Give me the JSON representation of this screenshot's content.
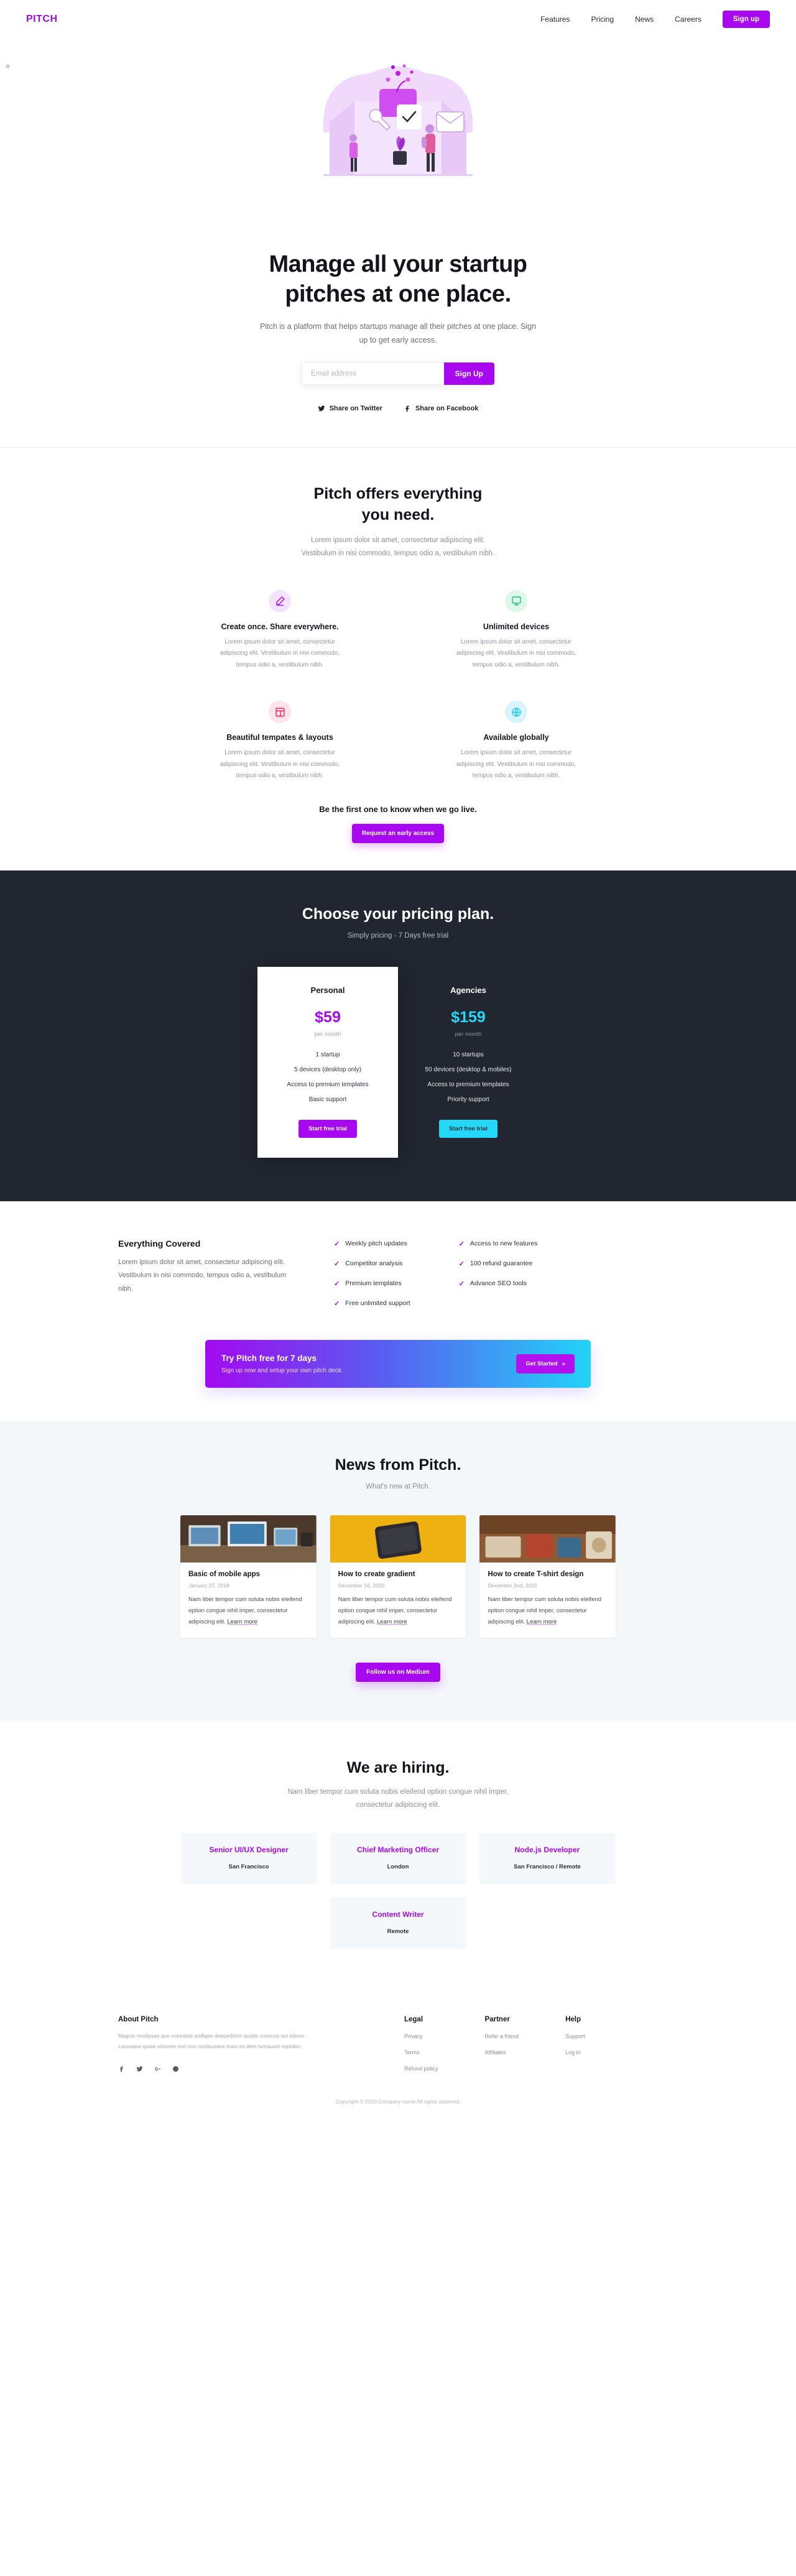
{
  "brand": {
    "logo": "PITCH",
    "accent": "#a708ef",
    "cyan": "#25d7f6",
    "dark": "#222630"
  },
  "nav": {
    "links": [
      {
        "label": "Features"
      },
      {
        "label": "Pricing"
      },
      {
        "label": "News"
      },
      {
        "label": "Careers"
      }
    ],
    "signup_label": "Sign up"
  },
  "hero": {
    "title_line1": "Manage all your startup",
    "title_line2": "pitches at one place.",
    "subtitle": "Pitch is a platform that helps startups manage all their pitches at one place. Sign up to get early access.",
    "email_placeholder": "Email address",
    "email_value": "",
    "signup_label": "Sign Up",
    "share_twitter": "Share on Twitter",
    "share_facebook": "Share on Facebook"
  },
  "features": {
    "title_line1": "Pitch offers everything",
    "title_line2": "you need.",
    "subtitle": "Lorem ipsum dolor sit amet, consectetur adipiscing elit. Vestibulum in nisi commodo, tempus odio a, vestibulum nibh.",
    "items": [
      {
        "icon": "pen-icon",
        "icon_bg": "#f4e3fb",
        "icon_color": "#a708ef",
        "title": "Create once. Share everywhere.",
        "text": "Lorem ipsum dolor sit amet, consectetur adipiscing elit. Vestibulum in nisi commodo, tempus odio a, vestibulum nibh."
      },
      {
        "icon": "monitor-icon",
        "icon_bg": "#ddf7ea",
        "icon_color": "#17c37b",
        "title": "Unlimited devices",
        "text": "Lorem ipsum dolor sit amet, consectetur adipiscing elit. Vestibulum in nisi commodo, tempus odio a, vestibulum nibh."
      },
      {
        "icon": "layout-icon",
        "icon_bg": "#fde3ea",
        "icon_color": "#f4225c",
        "title": "Beautiful tempates & layouts",
        "text": "Lorem ipsum dolor sit amet, consectetur adipiscing elit. Vestibulum in nisi commodo, tempus odio a, vestibulum nibh."
      },
      {
        "icon": "globe-icon",
        "icon_bg": "#d9f4fd",
        "icon_color": "#1ec8f0",
        "title": "Available globally",
        "text": "Lorem ipsum dolor sit amet, consectetur adipiscing elit. Vestibulum in nisi commodo, tempus odio a, vestibulum nibh."
      }
    ],
    "cta_heading": "Be the first one to know when we go live.",
    "cta_button": "Request an early access"
  },
  "pricing": {
    "title": "Choose your pricing plan.",
    "subtitle": "Simply pricing - 7 Days free trial",
    "plans": [
      {
        "name": "Personal",
        "price": "$59",
        "period": "per month",
        "features": [
          "1 startup",
          "5 devices (desktop only)",
          "Access to premium templates",
          "Basic support"
        ],
        "button": "Start free trial"
      },
      {
        "name": "Agencies",
        "price": "$159",
        "period": "per month",
        "features": [
          "10 startups",
          "50 devices (desktop & mobiles)",
          "Access to premium templates",
          "Priority support"
        ],
        "button": "Start free trial"
      }
    ]
  },
  "covered": {
    "title": "Everything Covered",
    "text": "Lorem ipsum dolor sit amet, consectetur adipiscing elit. Vestibulum in nisi commodo, tempus odio a, vestibulum nibh.",
    "col1": [
      "Weekly pitch updates",
      "Competitor analysis",
      "Premium templates",
      "Free unlimited support"
    ],
    "col2": [
      "Access to new features",
      "100 refund guarantee",
      "Advance SEO tools"
    ]
  },
  "try_banner": {
    "title": "Try Pitch free for 7 days",
    "subtitle": "Sign up now and setup your own pitch deck.",
    "button": "Get Started",
    "button_arrow": "»"
  },
  "news": {
    "title": "News from Pitch.",
    "subtitle": "What's new at Pitch.",
    "cards": [
      {
        "thumb": "desk-computers-photo",
        "title": "Basic of mobile apps",
        "date": "January 27, 2018",
        "text": "Nam liber tempor cum soluta nobis eleifend option congue nihil imper, consectetur adipiscing elit. ",
        "link": "Learn more"
      },
      {
        "thumb": "yellow-phone-photo",
        "title": "How to create gradient",
        "date": "December 16, 2020",
        "text": "Nam liber tempor cum soluta nobis eleifend option congue nihil imper, consectetur adipiscing elit. ",
        "link": "Learn more"
      },
      {
        "thumb": "workspace-photo",
        "title": "How to create T-shirt design",
        "date": "December 2nd, 2020",
        "text": "Nam liber tempor cum soluta nobis eleifend option congue nihil imper, consectetur adipiscing elit. ",
        "link": "Learn more"
      }
    ],
    "button": "Follow us on Medium"
  },
  "hiring": {
    "title": "We are hiring.",
    "subtitle": "Nam liber tempor cum soluta nobis eleifend option congue nihil imper, consectetur adipiscing elit.",
    "jobs": [
      {
        "title": "Senior UI/UX Designer",
        "location": "San Francisco"
      },
      {
        "title": "Chief Marketing Officer",
        "location": "London"
      },
      {
        "title": "Node.js Developer",
        "location": "San Francisco / Remote"
      },
      {
        "title": "Content Writer",
        "location": "Remote"
      }
    ]
  },
  "footer": {
    "about_title": "About Pitch",
    "about_text": "Magnis modipsae que voloratati andigen daepeditem quiate conecus aut labore. Laceaque quiae sitiorem rest non restibusaes maio es dem tumquam explabo.",
    "socials": [
      "facebook-icon",
      "twitter-icon",
      "googleplus-icon",
      "dribbble-icon"
    ],
    "columns": [
      {
        "title": "Legal",
        "links": [
          "Privacy",
          "Terms",
          "Refund policy"
        ]
      },
      {
        "title": "Partner",
        "links": [
          "Refer a friend",
          "Affiliates"
        ]
      },
      {
        "title": "Help",
        "links": [
          "Support",
          "Log in"
        ]
      }
    ],
    "copyright": "Copyright © 2020.Company name All rights reserved."
  }
}
